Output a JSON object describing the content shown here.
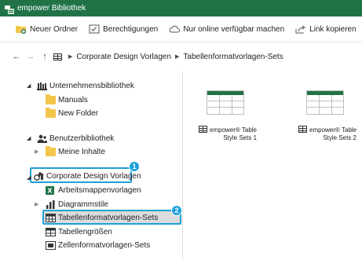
{
  "window": {
    "title": "empower Bibliothek",
    "accent": "#217346"
  },
  "toolbar": {
    "new_folder": "Neuer Ordner",
    "permissions": "Berechtigungen",
    "online_only": "Nur online verfügbar machen",
    "copy_link": "Link kopieren"
  },
  "breadcrumb": {
    "items": [
      "Corporate Design Vorlagen",
      "Tabellenformatvorlagen-Sets"
    ]
  },
  "tree": {
    "company_library": "Unternehmensbibliothek",
    "manuals": "Manuals",
    "new_folder": "New Folder",
    "user_library": "Benutzerbibliothek",
    "my_content": "Meine Inhalte",
    "corporate_design": "Corporate Design Vorlagen",
    "workbook_templates": "Arbeitsmappenvorlagen",
    "chart_styles": "Diagrammstile",
    "table_format_sets": "Tabellenformatvorlagen-Sets",
    "table_sizes": "Tabellengrößen",
    "cell_format_sets": "Zellenformatvorlagen-Sets"
  },
  "badges": {
    "one": "1",
    "two": "2"
  },
  "highlight_color": "#1ea1d9",
  "files": [
    {
      "line1": "empower® Table",
      "line2": "Style Sets 1"
    },
    {
      "line1": "empower® Table",
      "line2": "Style Sets 2"
    }
  ]
}
